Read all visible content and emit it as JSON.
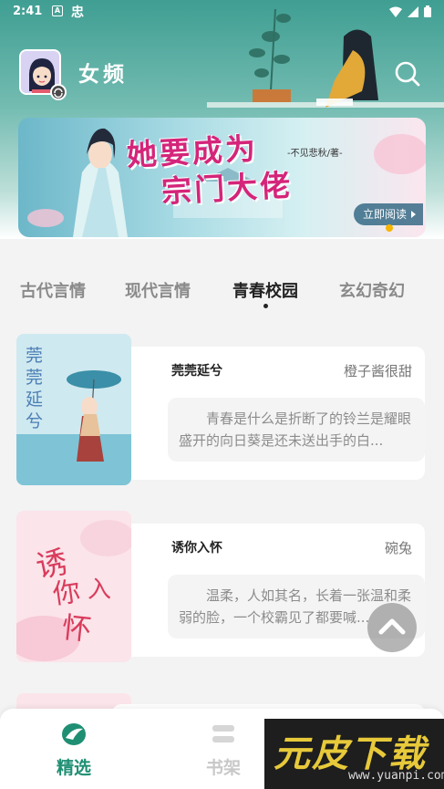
{
  "status_bar": {
    "time": "2:41",
    "icon_a": "A",
    "icon_b": "忠"
  },
  "header": {
    "title": "女频",
    "banner": {
      "title_line1": "她要成为",
      "title_line2": "宗门大佬",
      "author": "-不见悲秋/著-",
      "read_button": "立即阅读"
    }
  },
  "tabs": [
    {
      "label": "古代言情",
      "active": false
    },
    {
      "label": "现代言情",
      "active": false
    },
    {
      "label": "青春校园",
      "active": true
    },
    {
      "label": "玄幻奇幻",
      "active": false
    }
  ],
  "books": [
    {
      "title": "莞莞延兮",
      "author": "橙子酱很甜",
      "description": "青春是什么是折断了的铃兰是耀眼盛开的向日葵是还未送出手的白...",
      "cover_text": "莞莞延兮"
    },
    {
      "title": "诱你入怀",
      "author": "碗兔",
      "description": "温柔，人如其名，长着一张温和柔弱的脸，一个校霸见了都要喊...",
      "cover_text": "诱你入怀"
    }
  ],
  "bottom_nav": [
    {
      "label": "精选",
      "active": true,
      "icon": "featured-icon"
    },
    {
      "label": "书架",
      "active": false,
      "icon": "bookshelf-icon"
    }
  ],
  "watermark": {
    "text": "元皮下载",
    "url": "www.yuanpi.com"
  },
  "colors": {
    "accent": "#1f8f73",
    "header_teal": "#3f9e92",
    "banner_title": "#d4257a",
    "tab_active": "#222222",
    "tab_inactive": "#8a8a8a"
  }
}
